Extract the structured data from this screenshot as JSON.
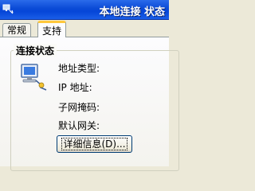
{
  "window": {
    "title": "本地连接 状态",
    "sys_icon": "network-connection-icon"
  },
  "tabs": [
    {
      "label": "常规",
      "selected": false
    },
    {
      "label": "支持",
      "selected": true
    }
  ],
  "group": {
    "title": "连接状态",
    "icon": "network-connection-icon",
    "fields": [
      {
        "label": "地址类型:"
      },
      {
        "label": "IP 地址:"
      },
      {
        "label": "子网掩码:"
      },
      {
        "label": "默认网关:"
      }
    ]
  },
  "buttons": {
    "details": "详细信息(D)..."
  },
  "colors": {
    "titlebar": "#0a4ad6",
    "tab_highlight": "#ffc83c",
    "dialog_bg": "#ece9d8"
  }
}
